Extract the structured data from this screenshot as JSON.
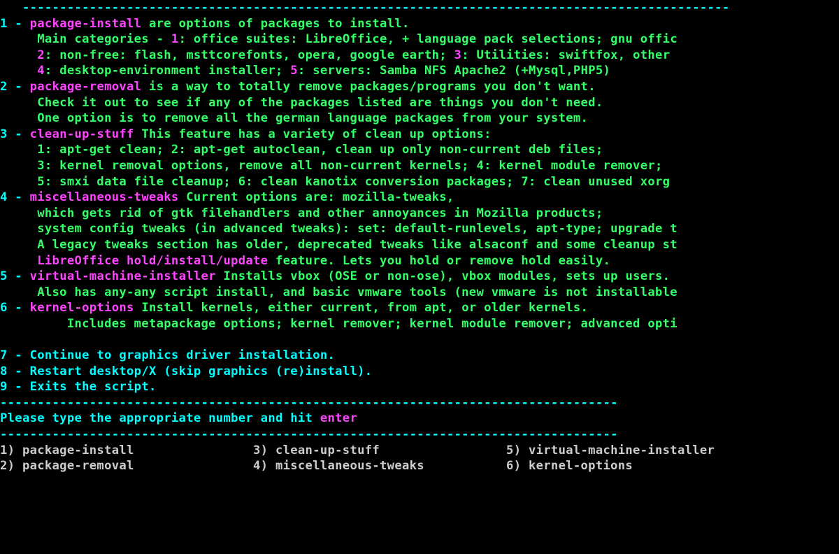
{
  "sep1": "   -----------------------------------------------------------------------------------------------",
  "items": [
    {
      "num": "1",
      "name": "package-install",
      "head_rest": " are options of packages to install.",
      "lines": [
        [
          {
            "c": "g",
            "t": "     Main categories - "
          },
          {
            "c": "m",
            "t": "1"
          },
          {
            "c": "g",
            "t": ": office suites: LibreOffice, + language pack selections; gnu offic"
          }
        ],
        [
          {
            "c": "g",
            "t": "     "
          },
          {
            "c": "m",
            "t": "2"
          },
          {
            "c": "g",
            "t": ": non-free: flash, msttcorefonts, opera, google earth; "
          },
          {
            "c": "m",
            "t": "3"
          },
          {
            "c": "g",
            "t": ": Utilities: swiftfox, other"
          }
        ],
        [
          {
            "c": "g",
            "t": "     "
          },
          {
            "c": "m",
            "t": "4"
          },
          {
            "c": "g",
            "t": ": desktop-environment installer; "
          },
          {
            "c": "m",
            "t": "5"
          },
          {
            "c": "g",
            "t": ": servers: Samba NFS Apache2 (+Mysql,PHP5)"
          }
        ]
      ]
    },
    {
      "num": "2",
      "name": "package-removal",
      "head_rest": " is a way to totally remove packages/programs you don't want.",
      "lines": [
        [
          {
            "c": "g",
            "t": "     Check it out to see if any of the packages listed are things you don't need."
          }
        ],
        [
          {
            "c": "g",
            "t": "     One option is to remove all the german language packages from your system."
          }
        ]
      ]
    },
    {
      "num": "3",
      "name": "clean-up-stuff",
      "head_rest": " This feature has a variety of clean up options:",
      "lines": [
        [
          {
            "c": "g",
            "t": "     1: apt-get clean; 2: apt-get autoclean, clean up only non-current deb files;"
          }
        ],
        [
          {
            "c": "g",
            "t": "     3: kernel removal options, remove all non-current kernels; 4: kernel module remover;"
          }
        ],
        [
          {
            "c": "g",
            "t": "     5: smxi data file cleanup; 6: clean kanotix conversion packages; 7: clean unused xorg"
          }
        ]
      ]
    },
    {
      "num": "4",
      "name": "miscellaneous-tweaks",
      "head_rest": " Current options are: mozilla-tweaks,",
      "lines": [
        [
          {
            "c": "g",
            "t": "     which gets rid of gtk filehandlers and other annoyances in Mozilla products;"
          }
        ],
        [
          {
            "c": "g",
            "t": "     system config tweaks (in advanced tweaks): set: default-runlevels, apt-type; upgrade t"
          }
        ],
        [
          {
            "c": "g",
            "t": "     A legacy tweaks section has older, deprecated tweaks like alsaconf and some cleanup st"
          }
        ],
        [
          {
            "c": "g",
            "t": "     "
          },
          {
            "c": "m",
            "t": "LibreOffice hold/install/update"
          },
          {
            "c": "g",
            "t": " feature. Lets you hold or remove hold easily."
          }
        ]
      ]
    },
    {
      "num": "5",
      "name": "virtual-machine-installer",
      "head_rest": " Installs vbox (OSE or non-ose), vbox modules, sets up users.",
      "lines": [
        [
          {
            "c": "g",
            "t": "     Also has any-any script install, and basic vmware tools (new vmware is not installable"
          }
        ]
      ]
    },
    {
      "num": "6",
      "name": "kernel-options",
      "head_rest": " Install kernels, either current, from apt, or older kernels.",
      "lines": [
        [
          {
            "c": "g",
            "t": "         Includes metapackage options; kernel remover; kernel module remover; advanced opti"
          }
        ]
      ]
    }
  ],
  "simple": [
    {
      "num": "7",
      "text": "Continue to graphics driver installation."
    },
    {
      "num": "8",
      "text": "Restart desktop/X (skip graphics (re)install)."
    },
    {
      "num": "9",
      "text": "Exits the script."
    }
  ],
  "sep2": "-----------------------------------------------------------------------------------",
  "prompt_pre": "Please type the appropriate number and hit ",
  "prompt_key": "enter",
  "sep3": "-----------------------------------------------------------------------------------",
  "options_row1": "1) package-install                3) clean-up-stuff                 5) virtual-machine-installer",
  "options_row2": "2) package-removal                4) miscellaneous-tweaks           6) kernel-options"
}
